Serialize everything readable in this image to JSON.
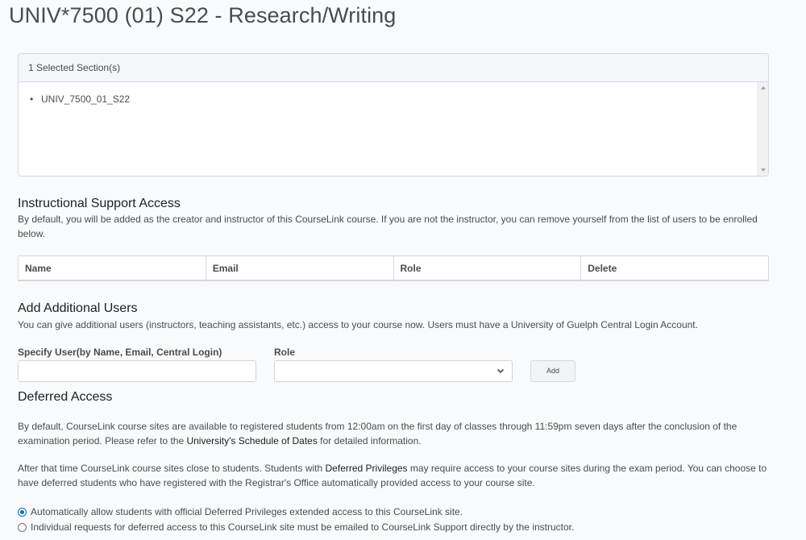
{
  "page": {
    "title": "UNIV*7500 (01) S22 - Research/Writing"
  },
  "sections": {
    "header": "1 Selected Section(s)",
    "items": [
      "UNIV_7500_01_S22"
    ]
  },
  "instructional_support": {
    "heading": "Instructional Support Access",
    "description": "By default, you will be added as the creator and instructor of this CourseLink course. If you are not the instructor, you can remove yourself from the list of users to be enrolled below.",
    "columns": [
      "Name",
      "Email",
      "Role",
      "Delete"
    ]
  },
  "additional_users": {
    "heading": "Add Additional Users",
    "description": "You can give additional users (instructors, teaching assistants, etc.) access to your course now. Users must have a University of Guelph Central Login Account.",
    "user_label": "Specify User(by Name, Email, Central Login)",
    "user_value": "",
    "role_label": "Role",
    "role_value": "",
    "add_label": "Add"
  },
  "deferred": {
    "heading": "Deferred Access",
    "para1_before": "By default, CourseLink course sites are available to registered students from 12:00am on the first day of classes through 11:59pm seven days after the conclusion of the examination period. Please refer to the ",
    "para1_link": "University's Schedule of Dates",
    "para1_after": " for detailed information.",
    "para2_before": "After that time CourseLink course sites close to students. Students with ",
    "para2_link": "Deferred Privileges",
    "para2_after": " may require access to your course sites during the exam period. You can choose to have deferred students who have registered with the Registrar's Office automatically provided access to your course site.",
    "options": [
      "Automatically allow students with official Deferred Privileges extended access to this CourseLink site.",
      "Individual requests for deferred access to this CourseLink site must be emailed to CourseLink Support directly by the instructor."
    ],
    "selected_option": 0
  },
  "colors": {
    "accent": "#006fbf",
    "text": "#494c4e",
    "border": "#d3d9e3"
  }
}
